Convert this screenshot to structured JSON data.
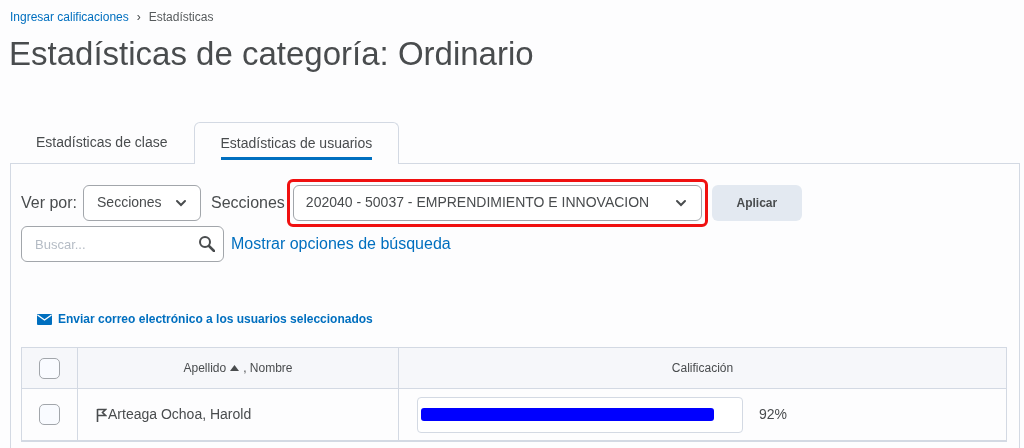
{
  "breadcrumb": {
    "link": "Ingresar calificaciones",
    "separator": "›",
    "current": "Estadísticas"
  },
  "title": "Estadísticas de categoría: Ordinario",
  "tabs": [
    {
      "label": "Estadísticas de clase",
      "selected": false
    },
    {
      "label": "Estadísticas de usuarios",
      "selected": true
    }
  ],
  "filters": {
    "view_label": "Ver por:",
    "view_value": "Secciones",
    "sections_label": "Secciones",
    "sections_value": "202040 - 50037 - EMPRENDIMIENTO E INNOVACION",
    "sections_highlighted": true,
    "apply": "Aplicar"
  },
  "search": {
    "placeholder": "Buscar...",
    "options_link": "Mostrar opciones de búsqueda"
  },
  "email_link": "Enviar correo electrónico a los usuarios seleccionados",
  "table": {
    "columns": [
      {
        "label": "Apellido",
        "suffix": ", Nombre"
      },
      {
        "label": "Calificación"
      }
    ],
    "header_checked": false,
    "rows": [
      {
        "name": "Arteaga Ochoa, Harold",
        "checked": false,
        "level": 0.92,
        "grade": "92%"
      }
    ]
  }
}
